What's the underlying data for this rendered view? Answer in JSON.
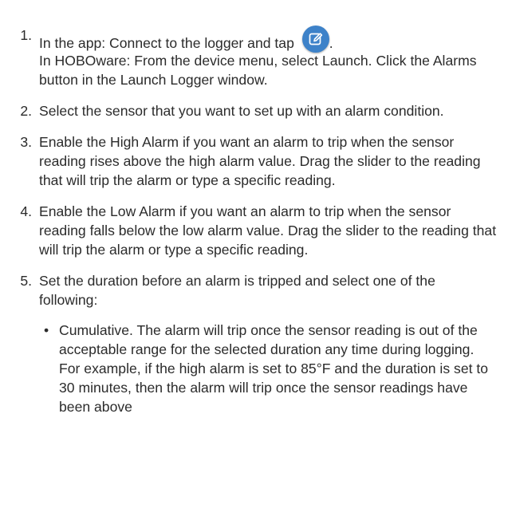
{
  "steps": [
    {
      "number": "1.",
      "text_before_icon": "In the app: Connect to the logger and tap",
      "text_after_icon": ".",
      "icon": "edit-pencil-icon",
      "icon_color": "#3d82c9",
      "continuation": "In HOBOware: From the device menu, select Launch. Click the Alarms button in the Launch Logger window."
    },
    {
      "number": "2.",
      "text": "Select the sensor that you want to set up with an alarm condition."
    },
    {
      "number": "3.",
      "text": "Enable the High Alarm if you want an alarm to trip when the sensor reading rises above the high alarm value. Drag the slider to the reading that will trip the alarm or type a specific reading."
    },
    {
      "number": "4.",
      "text": "Enable the Low Alarm if you want an alarm to trip when the sensor reading falls below the low alarm value. Drag the slider to the reading that will trip the alarm or type a specific reading."
    },
    {
      "number": "5.",
      "text": "Set the duration before an alarm is tripped and select one of the following:",
      "sub_items": [
        {
          "bullet": "•",
          "text": "Cumulative. The alarm will trip once the sensor reading is out of the acceptable range for the selected duration any time during logging. For example, if the high alarm is set to 85°F and the duration is set to 30 minutes, then the alarm will trip once the sensor readings have been above"
        }
      ]
    }
  ]
}
